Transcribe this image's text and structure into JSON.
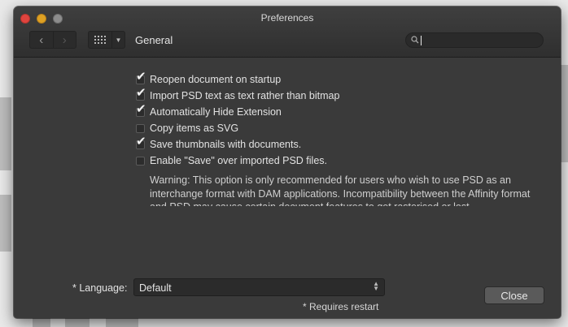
{
  "window": {
    "title": "Preferences"
  },
  "toolbar": {
    "back_icon": "chevron-left-icon",
    "forward_icon": "chevron-right-icon",
    "grid_icon": "grid-icon",
    "dropdown_icon": "chevron-down-icon",
    "page_label": "General",
    "search": {
      "value": "",
      "placeholder": ""
    }
  },
  "options": [
    {
      "label": "Reopen document on startup",
      "checked": true
    },
    {
      "label": "Import PSD text as text rather than bitmap",
      "checked": true
    },
    {
      "label": "Automatically Hide Extension",
      "checked": true
    },
    {
      "label": "Copy items as SVG",
      "checked": false
    },
    {
      "label": "Save thumbnails with documents.",
      "checked": true
    },
    {
      "label": "Enable \"Save\" over imported PSD files.",
      "checked": false
    }
  ],
  "warning": "Warning: This option is only recommended for users who wish to use PSD as an interchange format with DAM applications. Incompatibility between the Affinity format and PSD may cause certain document features to get rasterised or lost.",
  "language": {
    "label": "* Language:",
    "value": "Default"
  },
  "restart_note": "* Requires restart",
  "close_label": "Close",
  "colors": {
    "window_bg": "#3a3a3a",
    "close_traffic": "#e0443e",
    "min_traffic": "#dea123"
  }
}
